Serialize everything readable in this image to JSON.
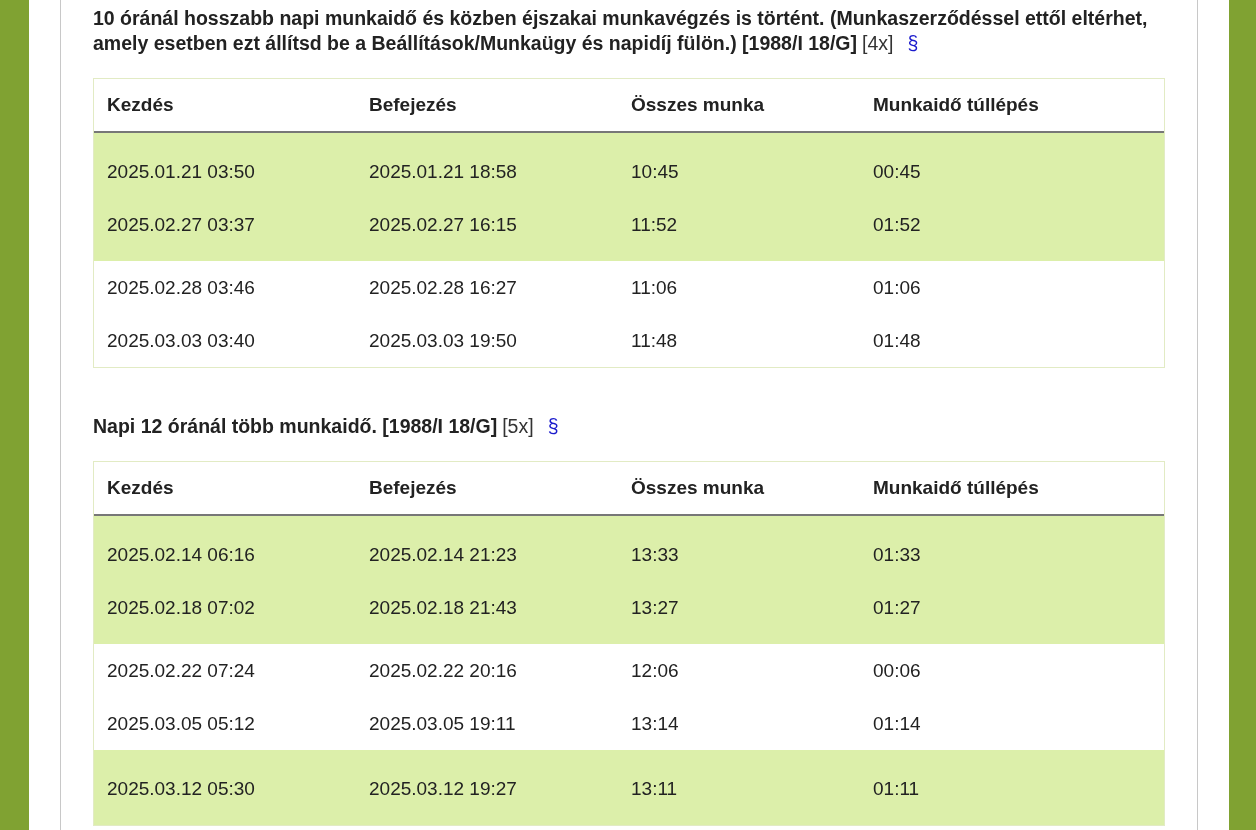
{
  "sections": [
    {
      "title": "10 óránál hosszabb napi munkaidő és közben éjszakai munkavégzés is történt. (Munkaszerződéssel ettől eltérhet, amely esetben ezt állítsd be a Beállítások/Munkaügy és napidíj fülön.) [1988/I 18/G]",
      "count": "[4x]",
      "link": "§",
      "table": {
        "columns": [
          "Kezdés",
          "Befejezés",
          "Összes munka",
          "Munkaidő túllépés"
        ],
        "groups": [
          {
            "highlighted": true,
            "rows": [
              [
                "2025.01.21 03:50",
                "2025.01.21 18:58",
                "10:45",
                "00:45"
              ],
              [
                "2025.02.27 03:37",
                "2025.02.27 16:15",
                "11:52",
                "01:52"
              ]
            ]
          },
          {
            "highlighted": false,
            "rows": [
              [
                "2025.02.28 03:46",
                "2025.02.28 16:27",
                "11:06",
                "01:06"
              ],
              [
                "2025.03.03 03:40",
                "2025.03.03 19:50",
                "11:48",
                "01:48"
              ]
            ]
          }
        ]
      }
    },
    {
      "title": "Napi 12 óránál több munkaidő. [1988/I 18/G]",
      "count": "[5x]",
      "link": "§",
      "table": {
        "columns": [
          "Kezdés",
          "Befejezés",
          "Összes munka",
          "Munkaidő túllépés"
        ],
        "groups": [
          {
            "highlighted": true,
            "rows": [
              [
                "2025.02.14 06:16",
                "2025.02.14 21:23",
                "13:33",
                "01:33"
              ],
              [
                "2025.02.18 07:02",
                "2025.02.18 21:43",
                "13:27",
                "01:27"
              ]
            ]
          },
          {
            "highlighted": false,
            "rows": [
              [
                "2025.02.22 07:24",
                "2025.02.22 20:16",
                "12:06",
                "00:06"
              ],
              [
                "2025.03.05 05:12",
                "2025.03.05 19:11",
                "13:14",
                "01:14"
              ]
            ]
          },
          {
            "highlighted": true,
            "rows": [
              [
                "2025.03.12 05:30",
                "2025.03.12 19:27",
                "13:11",
                "01:11"
              ]
            ]
          }
        ]
      }
    }
  ]
}
